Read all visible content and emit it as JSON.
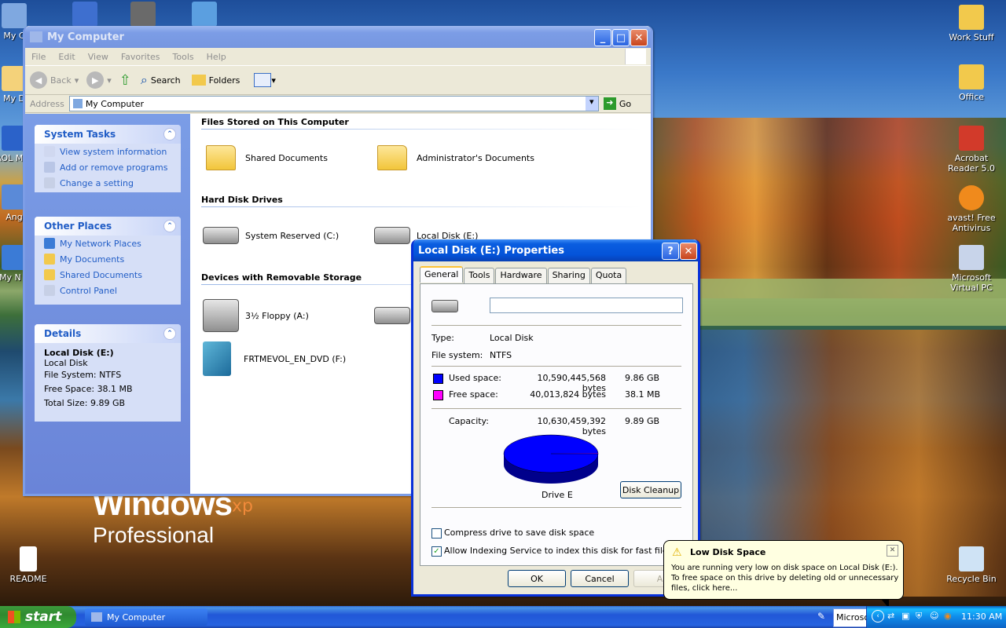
{
  "desktop": {
    "icons_left": [
      {
        "label": "My C"
      },
      {
        "label": "My D"
      },
      {
        "label": "AOL Mes"
      },
      {
        "label": "Ang"
      },
      {
        "label": "My N P"
      }
    ],
    "icons_right": [
      {
        "label": "Work Stuff"
      },
      {
        "label": "Office"
      },
      {
        "label": "Acrobat Reader 5.0"
      },
      {
        "label": "avast! Free Antivirus"
      },
      {
        "label": "Microsoft Virtual PC"
      },
      {
        "label": "Recycle Bin"
      }
    ],
    "readme_label": "README",
    "logo_windows": "Windows",
    "logo_xp": "xp",
    "logo_edition": "Professional"
  },
  "my_computer": {
    "title": "My Computer",
    "menu": [
      "File",
      "Edit",
      "View",
      "Favorites",
      "Tools",
      "Help"
    ],
    "toolbar": {
      "back": "Back",
      "search": "Search",
      "folders": "Folders"
    },
    "address": {
      "label": "Address",
      "value": "My Computer",
      "go": "Go"
    },
    "system_tasks": {
      "title": "System Tasks",
      "items": [
        "View system information",
        "Add or remove programs",
        "Change a setting"
      ]
    },
    "other_places": {
      "title": "Other Places",
      "items": [
        "My Network Places",
        "My Documents",
        "Shared Documents",
        "Control Panel"
      ]
    },
    "details": {
      "title": "Details",
      "name": "Local Disk (E:)",
      "type": "Local Disk",
      "file_system": "File System: NTFS",
      "free_space": "Free Space: 38.1 MB",
      "total_size": "Total Size: 9.89 GB"
    },
    "groups": {
      "files": "Files Stored on This Computer",
      "hdd": "Hard Disk Drives",
      "removable": "Devices with Removable Storage"
    },
    "files_items": [
      "Shared Documents",
      "Administrator's Documents"
    ],
    "hdd_items": [
      "System Reserved (C:)",
      "Local Disk (E:)"
    ],
    "removable_items": [
      "3½ Floppy (A:)",
      "FRTMEVOL_EN_DVD (F:)"
    ]
  },
  "properties": {
    "title": "Local Disk (E:) Properties",
    "tabs": [
      "General",
      "Tools",
      "Hardware",
      "Sharing",
      "Quota"
    ],
    "name_value": "",
    "type_label": "Type:",
    "type_value": "Local Disk",
    "fs_label": "File system:",
    "fs_value": "NTFS",
    "used_label": "Used space:",
    "used_bytes": "10,590,445,568 bytes",
    "used_human": "9.86 GB",
    "free_label": "Free space:",
    "free_bytes": "40,013,824 bytes",
    "free_human": "38.1 MB",
    "capacity_label": "Capacity:",
    "capacity_bytes": "10,630,459,392 bytes",
    "capacity_human": "9.89 GB",
    "drive_label": "Drive E",
    "disk_cleanup": "Disk Cleanup",
    "compress_label": "Compress drive to save disk space",
    "compress_checked": false,
    "index_label": "Allow Indexing Service to index this disk for fast file searching",
    "index_checked": true,
    "ok": "OK",
    "cancel": "Cancel",
    "apply": "Ap",
    "used_color": "#0000ff",
    "free_color": "#ff00ff",
    "used_fraction": 0.9962
  },
  "balloon": {
    "title": "Low Disk Space",
    "text": "You are running very low on disk space on Local Disk (E:). To free space on this drive by deleting old or unnecessary files, click here..."
  },
  "taskbar": {
    "start": "start",
    "task_title": "My Computer",
    "microsoft_button": "Microsof",
    "clock": "11:30 AM"
  }
}
